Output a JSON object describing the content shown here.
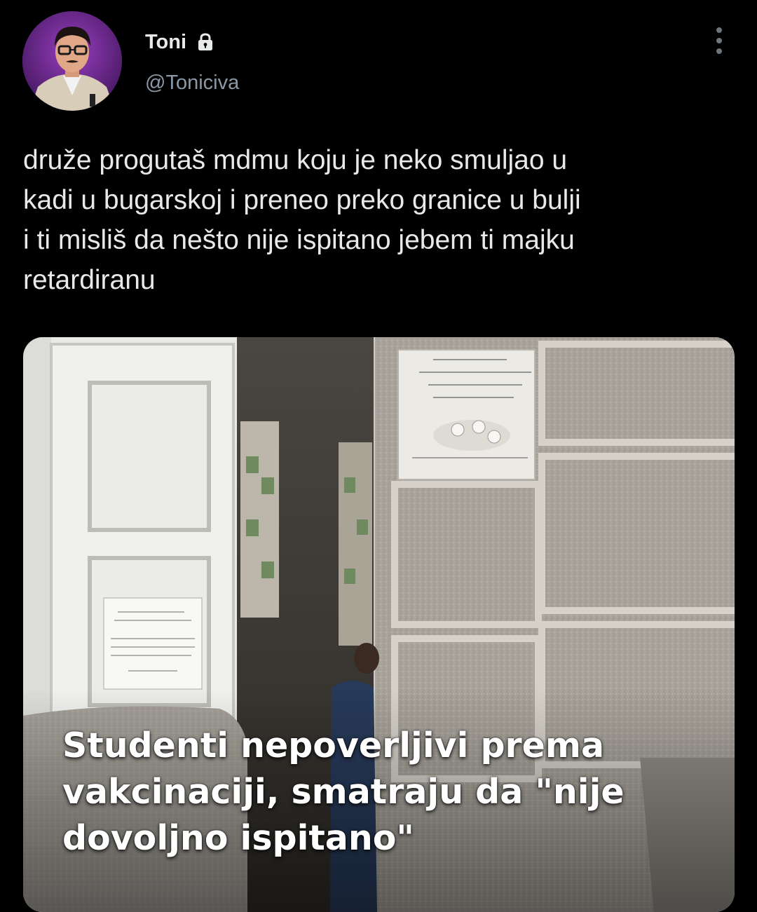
{
  "user": {
    "display_name": "Toni",
    "handle": "@Toniciva",
    "avatar_icon": "avatar-photo",
    "lock_icon": "lock-icon",
    "more_icon": "more-vertical-icon"
  },
  "tweet": {
    "text": "druže progutaš mdmu koju je neko smuljao u\nkadi u bugarskoj i preneo preko granice u bulji\ni ti misliš da nešto nije ispitano jebem ti majku\nretardiranu"
  },
  "media": {
    "headline": "Studenti nepoverljivi prema\nvakcinaciji, smatraju da \"nije\ndovoljno ispitano\""
  },
  "colors": {
    "background": "#000000",
    "primary_text": "#e7e9ea",
    "secondary_text": "#8b98a5",
    "avatar_background": "#6a2a8a"
  }
}
